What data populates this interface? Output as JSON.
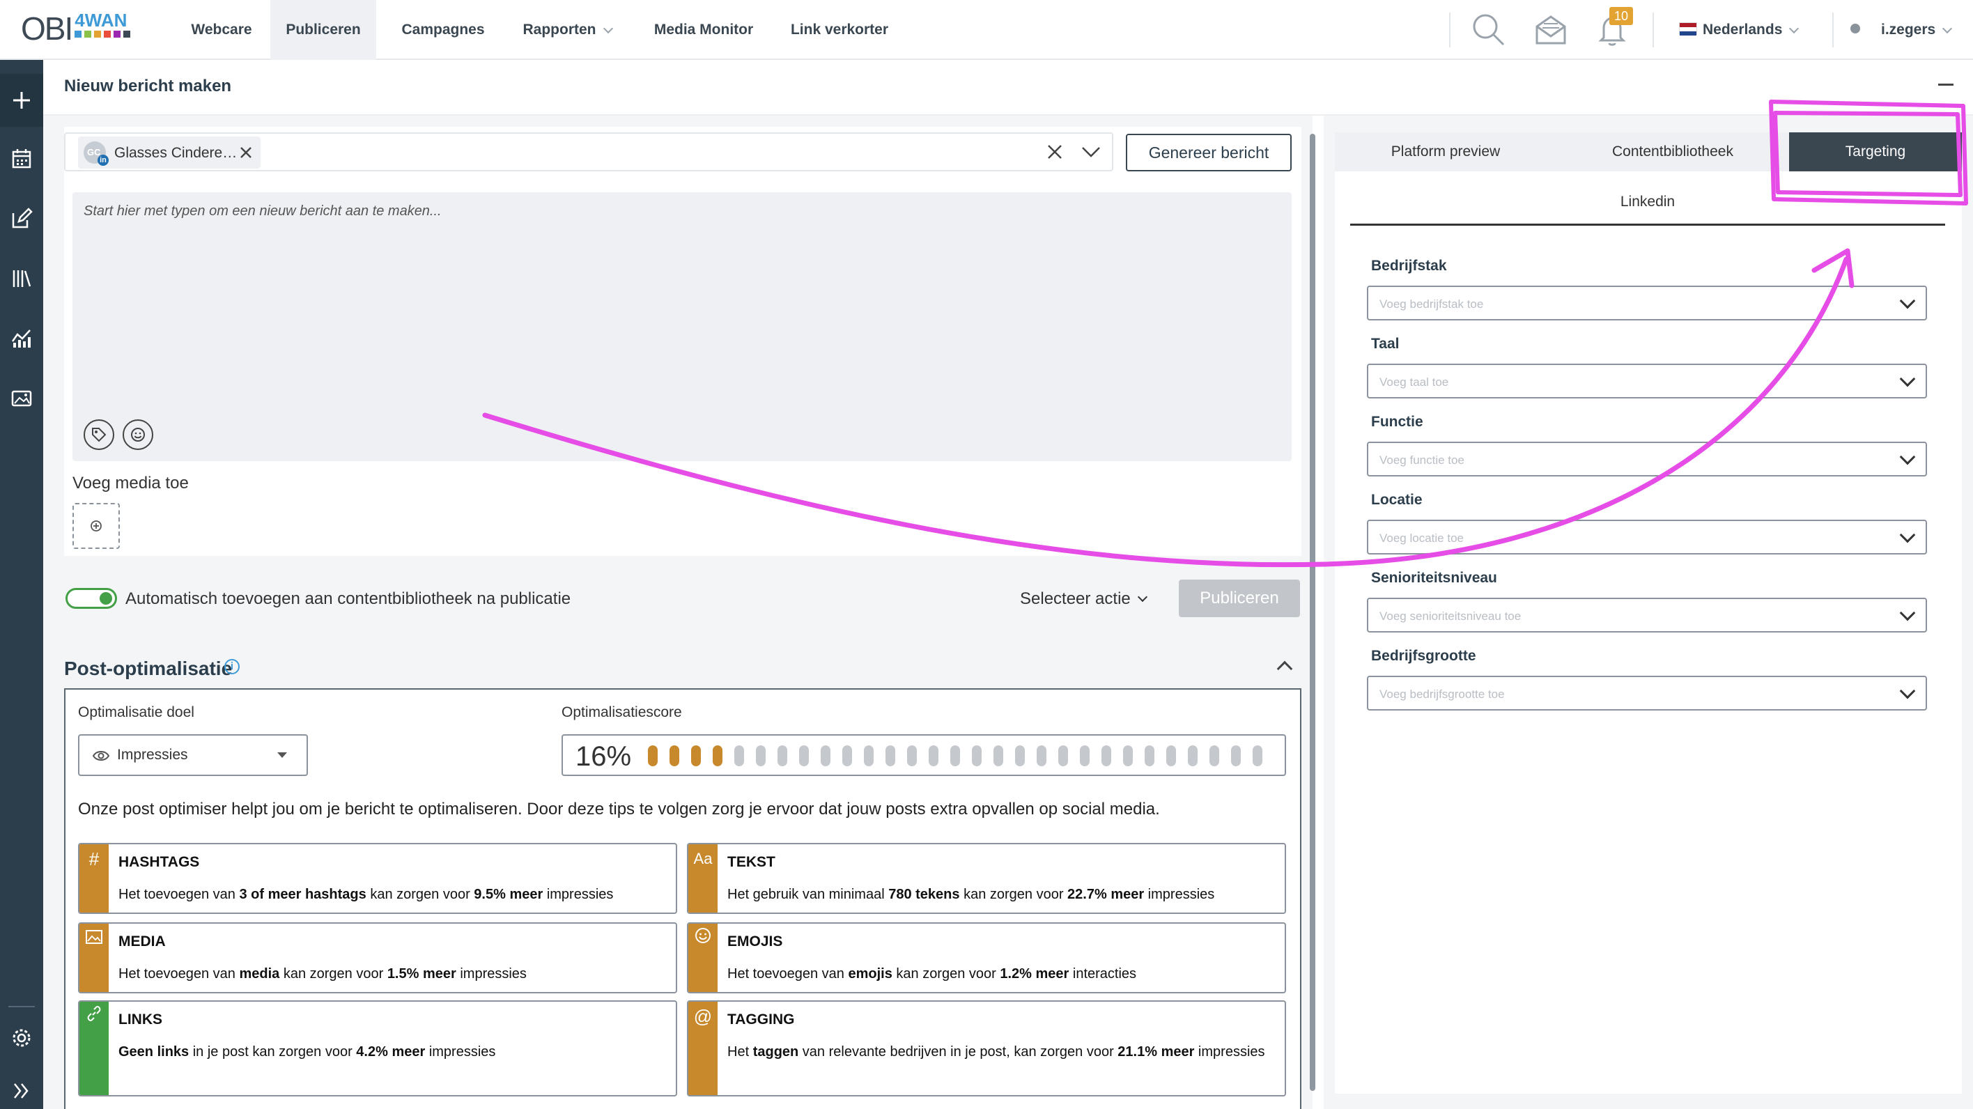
{
  "logo": {
    "text": "OBI",
    "sub": "4WAN",
    "colors": [
      "#3d9ad6",
      "#8bc34a",
      "#e3a333",
      "#e94e3c",
      "#9c27b0",
      "#3d4a55"
    ]
  },
  "nav": {
    "items": [
      "Webcare",
      "Publiceren",
      "Campagnes",
      "Rapporten",
      "Media Monitor",
      "Link verkorter"
    ],
    "active": "Publiceren",
    "notification_count": "10",
    "language": "Nederlands",
    "user": "i.zegers"
  },
  "header": {
    "title": "Nieuw bericht maken"
  },
  "composer": {
    "account_chip": "Glasses Cindere…",
    "account_initials": "GC",
    "account_network_badge": "in",
    "generate_button": "Genereer bericht",
    "editor_placeholder": "Start hier met typen om een nieuw bericht aan te maken...",
    "media_label": "Voeg media toe",
    "auto_add_label": "Automatisch toevoegen aan contentbibliotheek na publicatie",
    "auto_add_enabled": true,
    "select_action": "Selecteer actie",
    "publish_button": "Publiceren"
  },
  "optimization": {
    "title": "Post-optimalisatie",
    "goal_label": "Optimalisatie doel",
    "goal_value": "Impressies",
    "score_label": "Optimalisatiescore",
    "score_text": "16%",
    "score_value": 16,
    "score_segments_total": 29,
    "score_segments_filled": 4,
    "filled_color": "#c8892d",
    "empty_color": "#c5c9cd",
    "description": "Onze post optimiser helpt jou om je bericht te optimaliseren. Door deze tips te volgen zorg je ervoor dat jouw posts extra opvallen op social media.",
    "tips": [
      {
        "title": "HASHTAGS",
        "icon": "#",
        "color": "#c8892d",
        "parts": [
          [
            "Het toevoegen van ",
            false
          ],
          [
            "3 of meer hashtags",
            true
          ],
          [
            " kan zorgen voor ",
            false
          ],
          [
            "9.5% meer",
            true
          ],
          [
            " impressies",
            false
          ]
        ]
      },
      {
        "title": "TEKST",
        "icon": "Aa",
        "color": "#c8892d",
        "parts": [
          [
            "Het gebruik van minimaal ",
            false
          ],
          [
            "780 tekens",
            true
          ],
          [
            " kan zorgen voor ",
            false
          ],
          [
            "22.7% meer",
            true
          ],
          [
            " impressies",
            false
          ]
        ]
      },
      {
        "title": "MEDIA",
        "icon": "image-icon",
        "color": "#c8892d",
        "parts": [
          [
            "Het toevoegen van ",
            false
          ],
          [
            "media",
            true
          ],
          [
            " kan zorgen voor ",
            false
          ],
          [
            "1.5% meer",
            true
          ],
          [
            " impressies",
            false
          ]
        ]
      },
      {
        "title": "EMOJIS",
        "icon": "smiley-icon",
        "color": "#c8892d",
        "parts": [
          [
            "Het toevoegen van ",
            false
          ],
          [
            "emojis",
            true
          ],
          [
            " kan zorgen voor ",
            false
          ],
          [
            "1.2% meer",
            true
          ],
          [
            " interacties",
            false
          ]
        ]
      },
      {
        "title": "LINKS",
        "icon": "link-icon",
        "color": "#43a047",
        "parts": [
          [
            "Geen links",
            true
          ],
          [
            " in je post kan zorgen voor ",
            false
          ],
          [
            "4.2% meer",
            true
          ],
          [
            " impressies",
            false
          ]
        ]
      },
      {
        "title": "TAGGING",
        "icon": "@",
        "color": "#c8892d",
        "parts": [
          [
            "Het ",
            false
          ],
          [
            "taggen",
            true
          ],
          [
            " van relevante bedrijven in je post, kan zorgen voor ",
            false
          ],
          [
            "21.1% meer",
            true
          ],
          [
            " impressies",
            false
          ]
        ]
      }
    ]
  },
  "panel": {
    "tabs": [
      "Platform preview",
      "Contentbibliotheek",
      "Targeting"
    ],
    "active_tab": "Targeting",
    "subtab": "Linkedin",
    "fields": [
      {
        "label": "Bedrijfstak",
        "placeholder": "Voeg bedrijfstak toe"
      },
      {
        "label": "Taal",
        "placeholder": "Voeg taal toe"
      },
      {
        "label": "Functie",
        "placeholder": "Voeg functie toe"
      },
      {
        "label": "Locatie",
        "placeholder": "Voeg locatie toe"
      },
      {
        "label": "Senioriteitsniveau",
        "placeholder": "Voeg senioriteitsniveau toe"
      },
      {
        "label": "Bedrijfsgrootte",
        "placeholder": "Voeg bedrijfsgrootte toe"
      }
    ]
  },
  "annotation": {
    "color": "#e64ce6"
  }
}
